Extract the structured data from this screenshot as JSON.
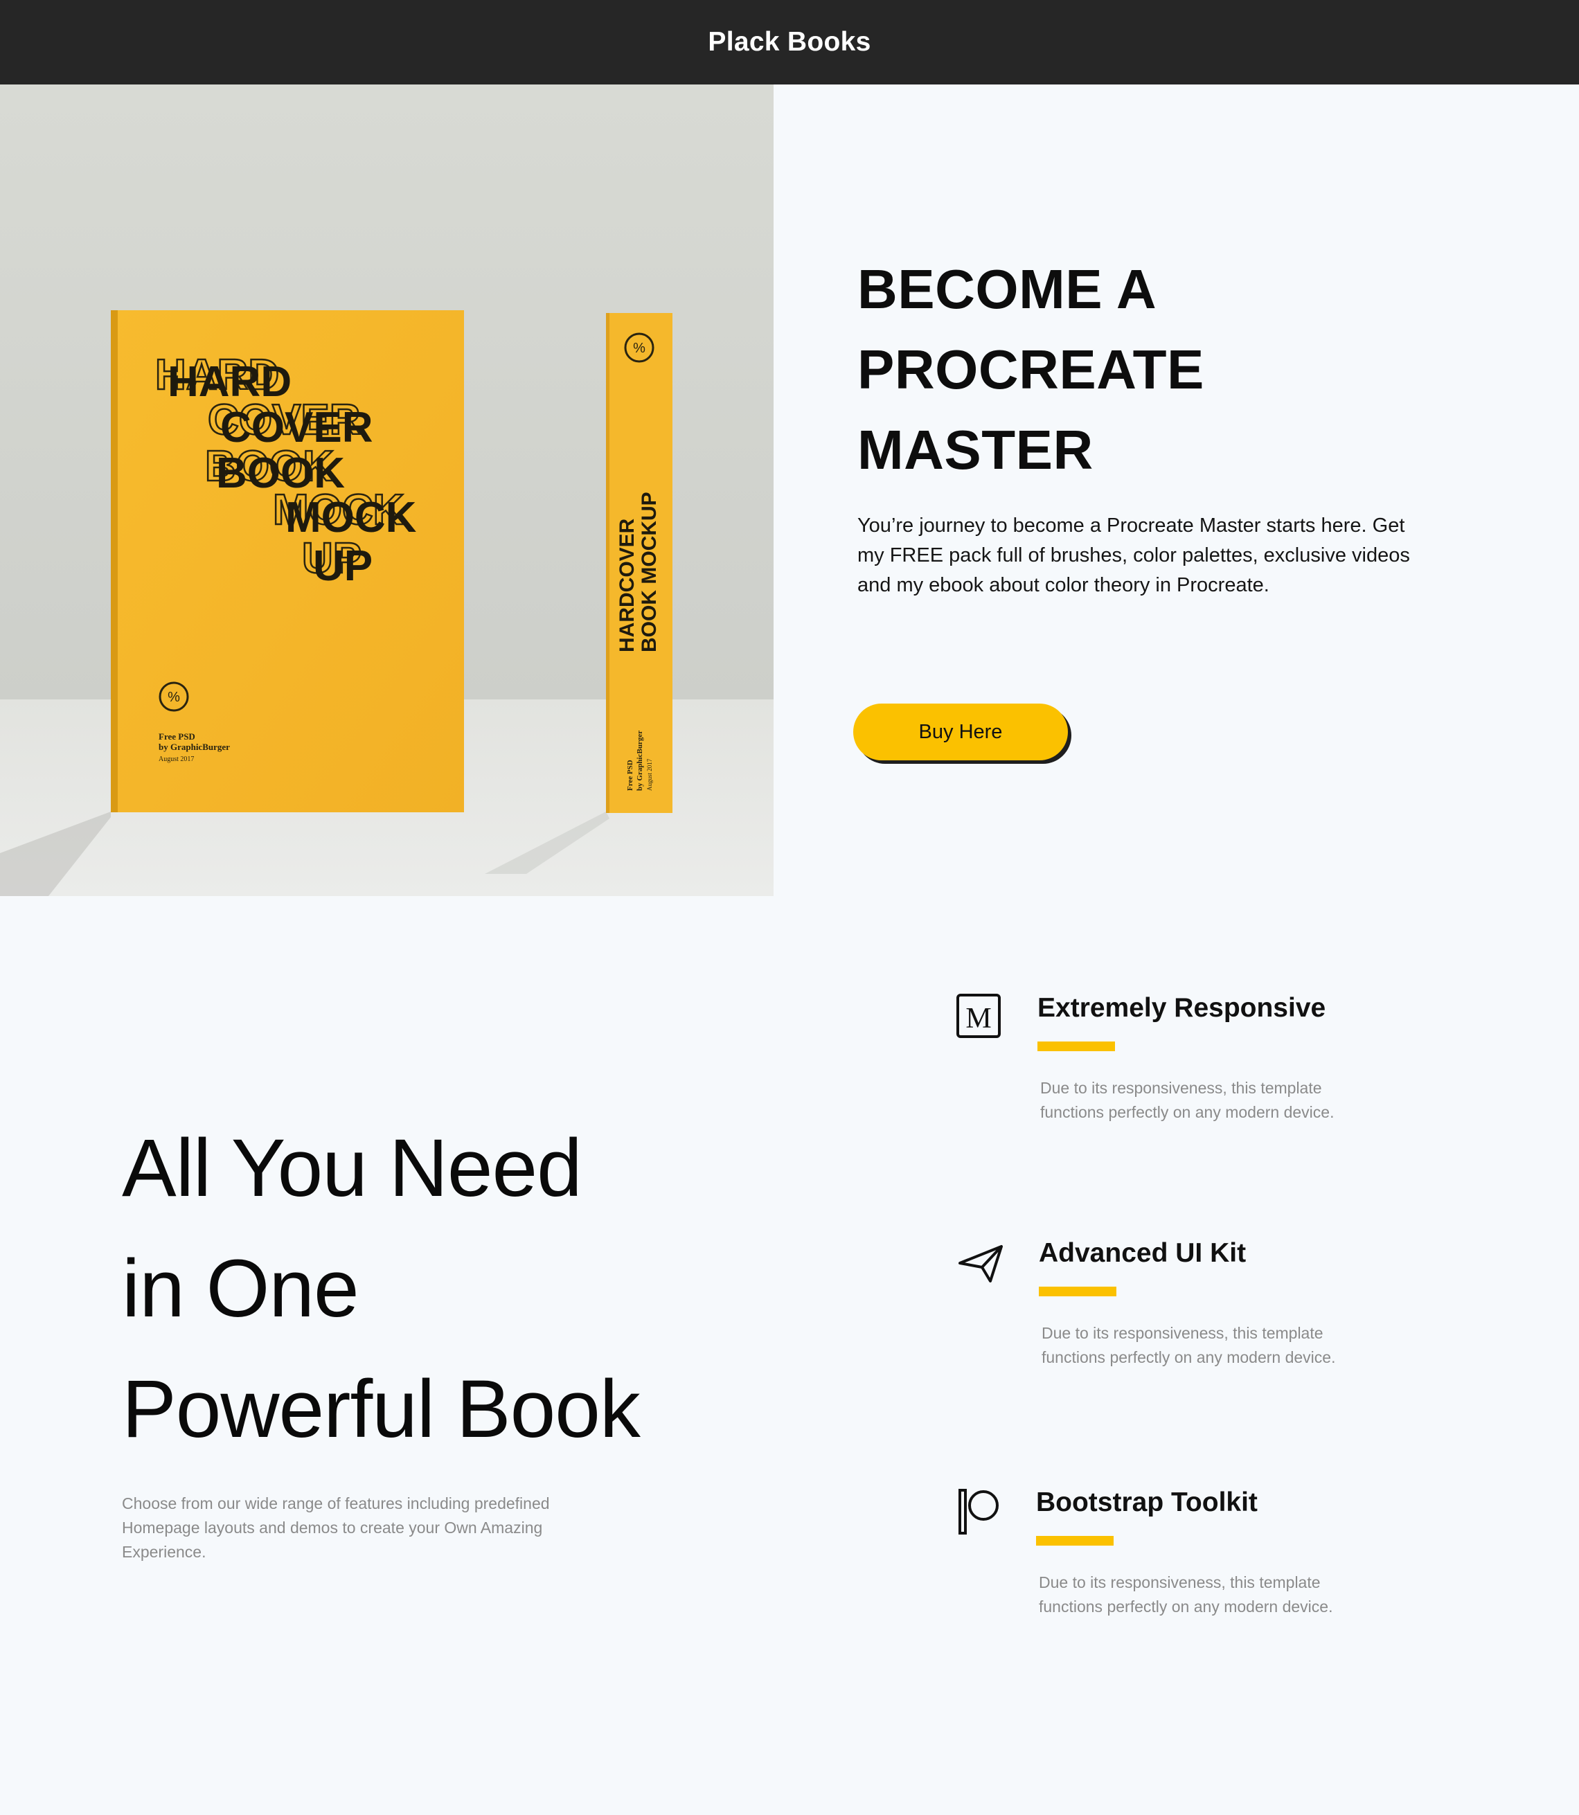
{
  "header": {
    "brand": "Plack Books"
  },
  "hero": {
    "image": {
      "cover_lines": [
        "HARD",
        "COVER",
        "BOOK",
        "MOCK",
        "UP"
      ],
      "cover_footer": [
        "Free PSD",
        "by GraphicBurger",
        "August 2017"
      ],
      "spine_title": [
        "HARDCOVER",
        "BOOK MOCKUP"
      ],
      "spine_footer": [
        "Free PSD",
        "by GraphicBurger",
        "August 2017"
      ]
    },
    "title_lines": [
      "BECOME A",
      "PROCREATE",
      "MASTER"
    ],
    "description": "You’re journey to become a Procreate Master starts here. Get my FREE pack full of brushes, color palettes, exclusive videos and my ebook about color theory in Procreate.",
    "cta_label": "Buy Here"
  },
  "features": {
    "title_lines": [
      "All You Need",
      "in One",
      "Powerful Book"
    ],
    "description": "Choose from our wide range of features including predefined Homepage layouts and demos to create your Own Amazing Experience.",
    "items": [
      {
        "icon": "medium-icon",
        "title": "Extremely Responsive",
        "description": "Due to its responsiveness, this template functions perfectly on any modern device."
      },
      {
        "icon": "paper-plane-icon",
        "title": "Advanced UI Kit",
        "description": "Due to its responsiveness, this template functions perfectly on any modern device."
      },
      {
        "icon": "patreon-icon",
        "title": "Bootstrap Toolkit",
        "description": "Due to its responsiveness, this template functions perfectly on any modern device."
      }
    ]
  },
  "colors": {
    "accent": "#fbc100",
    "topbar": "#262626",
    "background": "#f6f9fc",
    "book": "#f5b82c"
  }
}
